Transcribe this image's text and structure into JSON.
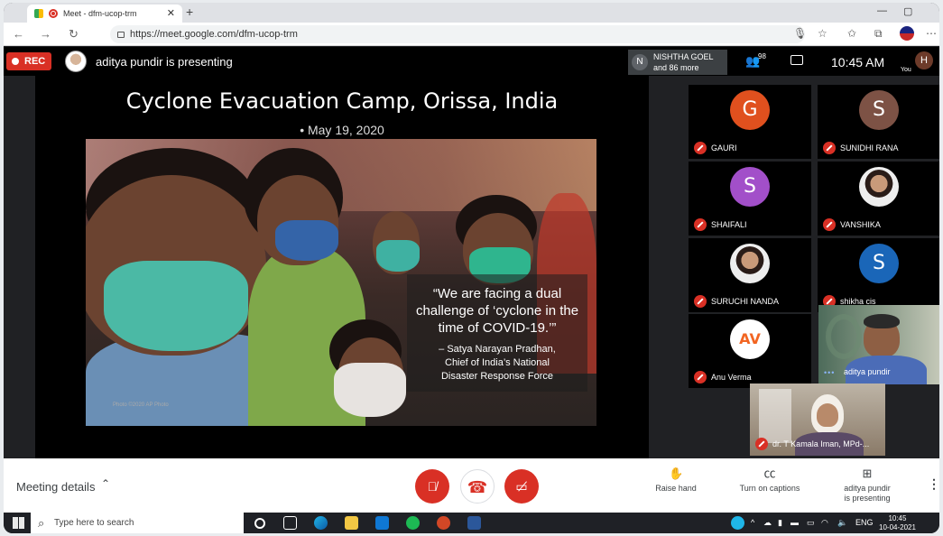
{
  "browser": {
    "tab_title": "Meet - dfm-ucop-trm",
    "new_tab": "+",
    "url": "https://meet.google.com/dfm-ucop-trm"
  },
  "meet_header": {
    "rec_label": "REC",
    "presenting_text": "aditya pundir is presenting",
    "participants_chip_initial": "N",
    "participants_chip_name": "NISHTHA GOEL",
    "participants_chip_more": "and 86 more",
    "people_count": "98",
    "time": "10:45 AM",
    "you_initial": "H",
    "you_label": "You"
  },
  "slide": {
    "title": "Cyclone Evacuation Camp, Orissa, India",
    "date": "• May 19, 2020",
    "photo_credit": "Photo ©2020 AP Photo",
    "quote": "“We are facing a dual challenge of ‘cyclone in the time of COVID-19.’”",
    "attribution_lines": [
      "– Satya Narayan Pradhan,",
      "Chief of India’s National",
      "Disaster Response Force"
    ]
  },
  "participants": [
    {
      "initial": "G",
      "name": "GAURI",
      "color": "#e0501e",
      "muted": true
    },
    {
      "initial": "S",
      "name": "SUNIDHI RANA",
      "color": "#7d5245",
      "muted": true
    },
    {
      "initial": "S",
      "name": "SHAIFALI",
      "color": "#a24fc9",
      "muted": true
    },
    {
      "initial": "",
      "name": "VANSHIKA",
      "color": "#e8e8e8",
      "muted": true,
      "photo": true
    },
    {
      "initial": "",
      "name": "SURUCHI NANDA",
      "color": "#e8e8e8",
      "muted": true,
      "photo": true
    },
    {
      "initial": "S",
      "name": "shikha cis",
      "color": "#1a66b8",
      "muted": true
    },
    {
      "initial": "",
      "name": "Anu Verma",
      "color": "#ffffff",
      "muted": true,
      "logo": "AV"
    },
    {
      "name": "aditya pundir",
      "video": true,
      "speaking": "•••"
    },
    {
      "name": "dr. T Kamala Iman, MPd-...",
      "video": true,
      "muted": true
    }
  ],
  "controls": {
    "meeting_details": "Meeting details",
    "raise_hand": "Raise hand",
    "turn_on_captions": "Turn on captions",
    "presenting_line1": "aditya pundir",
    "presenting_line2": "is presenting"
  },
  "taskbar": {
    "search_placeholder": "Type here to search",
    "lang": "ENG",
    "time": "10:45",
    "date": "10-04-2021"
  }
}
